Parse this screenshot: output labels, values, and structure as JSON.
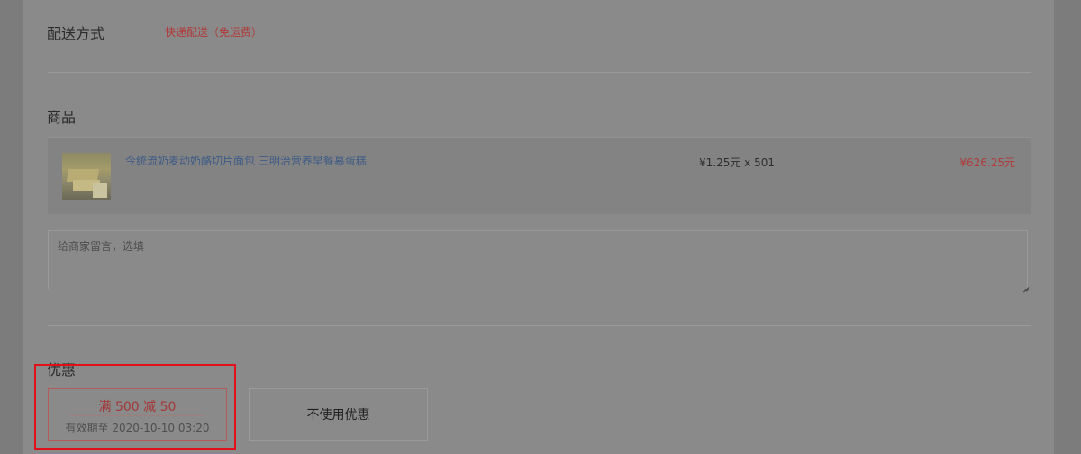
{
  "shipping": {
    "title": "配送方式",
    "value": "快递配送（免运费）"
  },
  "goods": {
    "title": "商品",
    "items": [
      {
        "name": "今统流奶麦动奶酪切片面包 三明治营养早餐慕蛋糕",
        "price_qty": "¥1.25元 x 501",
        "total": "¥626.25元",
        "image": "bread-product-image"
      }
    ]
  },
  "message": {
    "placeholder": "给商家留言，选填"
  },
  "discount": {
    "title": "优惠",
    "coupon": {
      "amount_label": "满 500 减 50",
      "expiry_label": "有效期至 2020-10-10 03:20"
    },
    "no_coupon_label": "不使用优惠"
  },
  "colors": {
    "accent_red": "#b13a3a",
    "link_blue": "#3f5b86",
    "highlight": "#e0101a"
  }
}
